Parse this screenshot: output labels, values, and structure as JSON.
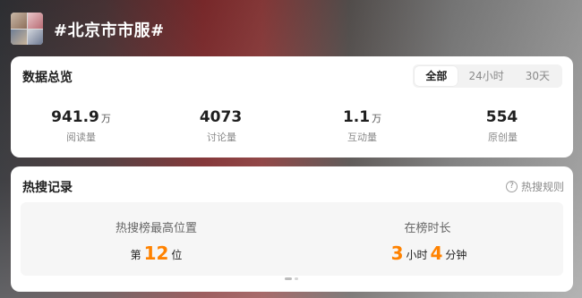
{
  "header": {
    "title": "#北京市市服#"
  },
  "overview": {
    "title": "数据总览",
    "tabs": [
      {
        "label": "全部",
        "active": true
      },
      {
        "label": "24小时",
        "active": false
      },
      {
        "label": "30天",
        "active": false
      }
    ],
    "stats": [
      {
        "value": "941.9",
        "unit": "万",
        "label": "阅读量"
      },
      {
        "value": "4073",
        "unit": "",
        "label": "讨论量"
      },
      {
        "value": "1.1",
        "unit": "万",
        "label": "互动量"
      },
      {
        "value": "554",
        "unit": "",
        "label": "原创量"
      }
    ]
  },
  "hot_search": {
    "title": "热搜记录",
    "rules_label": "热搜规则",
    "highest_position": {
      "label": "热搜榜最高位置",
      "prefix": "第",
      "value": "12",
      "suffix": "位"
    },
    "duration": {
      "label": "在榜时长",
      "hours": "3",
      "hours_unit": "小时",
      "minutes": "4",
      "minutes_unit": "分钟"
    }
  },
  "colors": {
    "accent_orange": "#ff8200"
  }
}
